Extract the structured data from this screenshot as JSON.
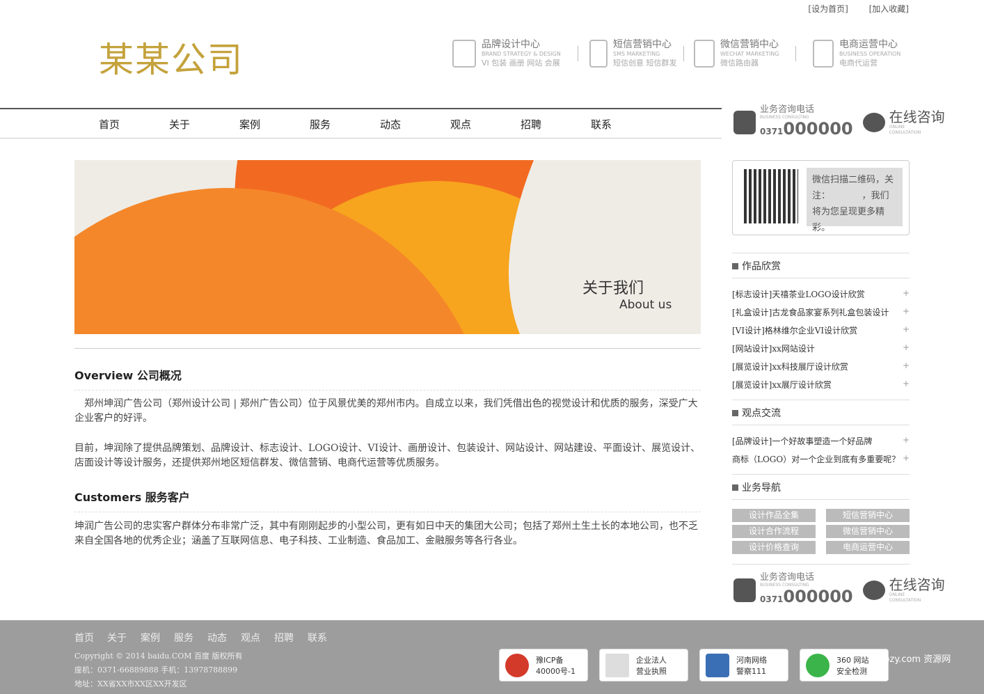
{
  "topbar": {
    "home": "[设为首页]",
    "fav": "[加入收藏]"
  },
  "logo": "某某公司",
  "features": [
    {
      "t1": "品牌设计中心",
      "t2": "BRAND STRATEGY & DESIGN",
      "t3": "VI 包装 画册 网站 会展"
    },
    {
      "t1": "短信营销中心",
      "t2": "SMS MARKETING",
      "t3": "短信创意 短信群发"
    },
    {
      "t1": "微信营销中心",
      "t2": "WECHAT MARKETING",
      "t3": "微信路由器"
    },
    {
      "t1": "电商运营中心",
      "t2": "BUSINESS OPERATION",
      "t3": "电商代运营"
    }
  ],
  "nav": [
    "首页",
    "关于",
    "案例",
    "服务",
    "动态",
    "观点",
    "招聘",
    "联系"
  ],
  "banner": {
    "cn": "关于我们",
    "en": "About us"
  },
  "overview": {
    "title": "Overview 公司概况",
    "p1": "郑州坤润广告公司（郑州设计公司 | 郑州广告公司）位于风景优美的郑州市内。自成立以来，我们凭借出色的视觉设计和优质的服务，深受广大企业客户的好评。",
    "p2": "目前，坤润除了提供品牌策划、品牌设计、标志设计、LOGO设计、VI设计、画册设计、包装设计、网站设计、网站建设、平面设计、展览设计、店面设计等设计服务，还提供郑州地区短信群发、微信营销、电商代运营等优质服务。"
  },
  "customers": {
    "title": "Customers 服务客户",
    "p1": "坤润广告公司的忠实客户群体分布非常广泛，其中有刚刚起步的小型公司，更有如日中天的集团大公司；包括了郑州土生土长的本地公司，也不乏来自全国各地的优秀企业；涵盖了互联网信息、电子科技、工业制造、食品加工、金融服务等各行各业。"
  },
  "contact": {
    "phone_label": "业务咨询电话",
    "phone_sub": "BUSINESS CONSULTING",
    "area": "0371",
    "number": "000000",
    "online": "在线咨询",
    "online_sub1": "ONLINE",
    "online_sub2": "CONSULTATION"
  },
  "qr": {
    "text": "微信扫描二维码，关注：　　　　，我们将为您呈现更多精彩。"
  },
  "works": {
    "title": "作品欣赏",
    "items": [
      "[标志设计]天禧茶业LOGO设计欣赏",
      "[礼盒设计]古龙食品家宴系列礼盒包装设计",
      "[VI设计]格林维尔企业VI设计欣赏",
      "[网站设计]xx网站设计",
      "[展览设计]xx科技展厅设计欣赏",
      "[展览设计]xx展厅设计欣赏"
    ]
  },
  "views": {
    "title": "观点交流",
    "items": [
      "[品牌设计]一个好故事塑造一个好品牌",
      "商标（LOGO）对一个企业到底有多重要呢？"
    ]
  },
  "biz": {
    "title": "业务导航",
    "buttons": [
      "设计作品全集",
      "短信营销中心",
      "设计合作流程",
      "微信营销中心",
      "设计价格查询",
      "电商运营中心"
    ]
  },
  "footer": {
    "nav": [
      "首页",
      "关于",
      "案例",
      "服务",
      "动态",
      "观点",
      "招聘",
      "联系"
    ],
    "copy": "Copyright © 2014 baidu.COM 百度 版权所有",
    "tel": "座机：0371-66889888 手机：13978788899",
    "addr": "地址：XX省XX市XX区XX开发区",
    "badges": [
      {
        "l1": "豫ICP备",
        "l2": "40000号-1"
      },
      {
        "l1": "企业法人",
        "l2": "营业执照"
      },
      {
        "l1": "河南网络",
        "l2": "警察111"
      },
      {
        "l1": "360 网站",
        "l2": "安全检测"
      }
    ],
    "watermark": "1pzy.com 资源网"
  },
  "colors": {
    "accent": "#c4a23c",
    "orange": "#f26a21",
    "footer": "#9e9d9d"
  }
}
